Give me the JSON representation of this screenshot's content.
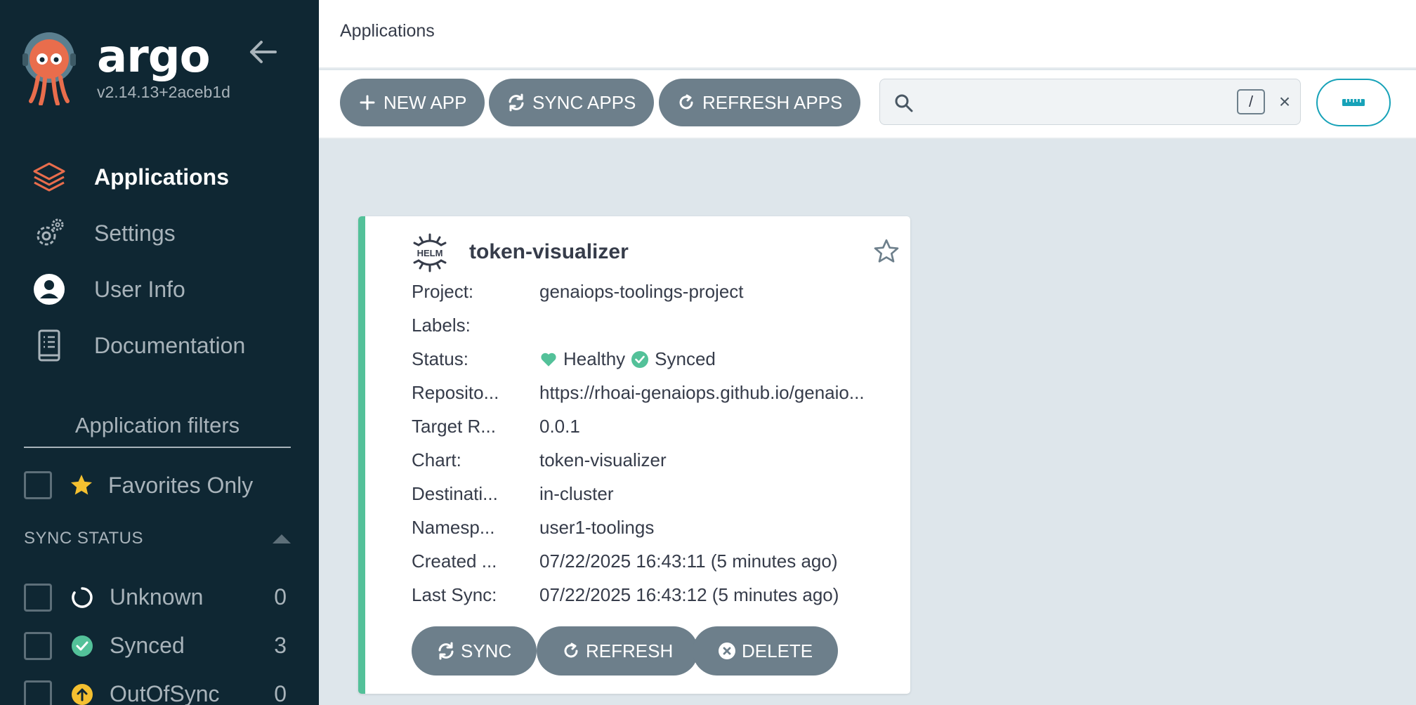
{
  "sidebar": {
    "brand": "argo",
    "version": "v2.14.13+2aceb1d",
    "nav": [
      {
        "label": "Applications",
        "icon": "layers-icon",
        "active": true
      },
      {
        "label": "Settings",
        "icon": "gear-icon"
      },
      {
        "label": "User Info",
        "icon": "user-icon"
      },
      {
        "label": "Documentation",
        "icon": "book-icon"
      }
    ],
    "filters_title": "Application filters",
    "favorites_label": "Favorites Only",
    "sync_status_title": "SYNC STATUS",
    "sync_filters": [
      {
        "label": "Unknown",
        "count": "0",
        "icon": "unknown-circle-icon"
      },
      {
        "label": "Synced",
        "count": "3",
        "icon": "synced-check-icon"
      },
      {
        "label": "OutOfSync",
        "count": "0",
        "icon": "out-of-sync-arrow-icon"
      }
    ]
  },
  "header": {
    "title": "Applications"
  },
  "toolbar": {
    "new_app": "NEW APP",
    "sync_apps": "SYNC APPS",
    "refresh_apps": "REFRESH APPS",
    "search_placeholder": "",
    "search_shortcut": "/",
    "clear": "×"
  },
  "app": {
    "name": "token-visualizer",
    "rows": [
      {
        "key": "Project:",
        "value": "genaiops-toolings-project"
      },
      {
        "key": "Labels:",
        "value": ""
      },
      {
        "key": "Status:",
        "health": "Healthy",
        "sync": "Synced"
      },
      {
        "key": "Reposito...",
        "value": "https://rhoai-genaiops.github.io/genaio..."
      },
      {
        "key": "Target R...",
        "value": "0.0.1"
      },
      {
        "key": "Chart:",
        "value": "token-visualizer"
      },
      {
        "key": "Destinati...",
        "value": "in-cluster"
      },
      {
        "key": "Namesp...",
        "value": "user1-toolings"
      },
      {
        "key": "Created ...",
        "value": "07/22/2025 16:43:11  (5 minutes ago)"
      },
      {
        "key": "Last Sync:",
        "value": "07/22/2025 16:43:12  (5 minutes ago)"
      }
    ],
    "actions": {
      "sync": "SYNC",
      "refresh": "REFRESH",
      "delete": "DELETE"
    }
  },
  "colors": {
    "sidebar_bg": "#0f2733",
    "accent_green": "#53c199",
    "button_gray": "#6d7f8b",
    "accent_teal": "#17a2b8",
    "warning_yellow": "#f4c030"
  }
}
